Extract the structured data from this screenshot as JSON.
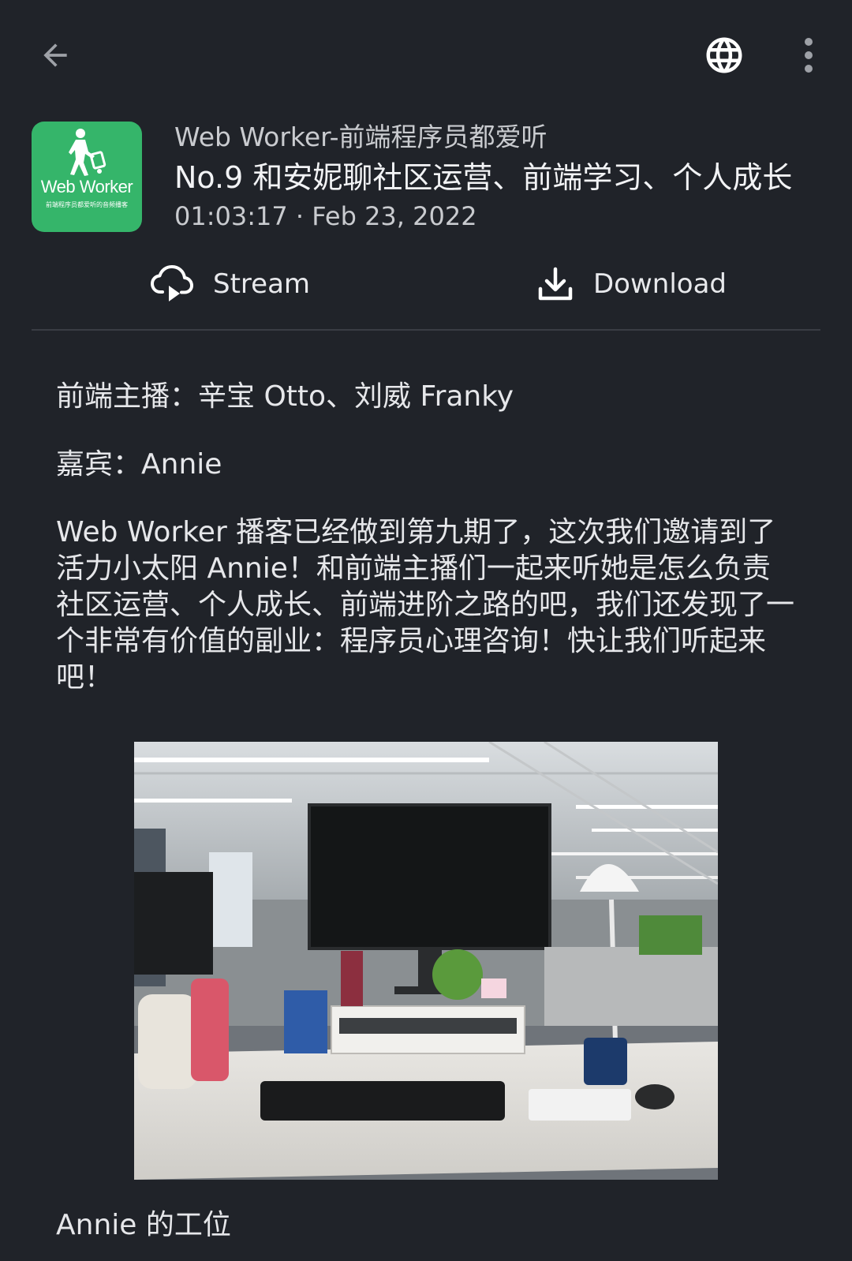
{
  "topbar": {
    "back_icon": "arrow-left-icon",
    "globe_icon": "globe-icon",
    "more_icon": "more-vertical-icon"
  },
  "podcast": {
    "name": "Web Worker-前端程序员都爱听",
    "artwork": {
      "logo_text": "Web Worker",
      "logo_subtext": "前端程序员都爱听的音频播客",
      "background_color": "#35b56a"
    }
  },
  "episode": {
    "title": "No.9 和安妮聊社区运营、前端学习、个人成长",
    "meta": "01:03:17 · Feb 23, 2022"
  },
  "actions": {
    "stream_label": "Stream",
    "stream_icon": "cloud-play-icon",
    "download_label": "Download",
    "download_icon": "download-icon"
  },
  "description": {
    "hosts": "前端主播：辛宝 Otto、刘威 Franky",
    "guest": "嘉宾：Annie",
    "body": "Web Worker 播客已经做到第九期了，这次我们邀请到了活力小太阳 Annie！和前端主播们一起来听她是怎么负责社区运营、个人成长、前端进阶之路的吧，我们还发现了一个非常有价值的副业：程序员心理咨询！快让我们听起来吧！"
  },
  "photo": {
    "caption": "Annie 的工位",
    "subject": "office-desk-photo"
  },
  "colors": {
    "background": "#202329",
    "text": "#e6e7ea",
    "secondary_text": "#c9cbcf",
    "divider": "#3a3d44"
  }
}
